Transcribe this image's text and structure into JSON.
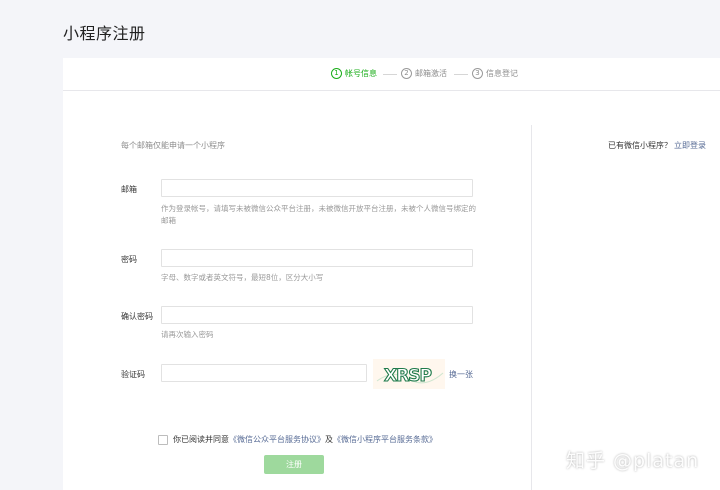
{
  "page": {
    "title": "小程序注册"
  },
  "steps": [
    {
      "num": "1",
      "label": "帐号信息"
    },
    {
      "num": "2",
      "label": "邮箱激活"
    },
    {
      "num": "3",
      "label": "信息登记"
    }
  ],
  "side": {
    "hint": "已有微信小程序？",
    "login_link": "立即登录"
  },
  "form": {
    "intro": "每个邮箱仅能申请一个小程序",
    "email_label": "邮箱",
    "email_tip": "作为登录帐号，请填写未被微信公众平台注册，未被微信开放平台注册，未被个人微信号绑定的邮箱",
    "password_label": "密码",
    "password_tip": "字母、数字或者英文符号，最短8位，区分大小写",
    "confirm_label": "确认密码",
    "confirm_tip": "请再次输入密码",
    "captcha_label": "验证码",
    "captcha_text": "XRSP",
    "refresh_link": "换一张",
    "agree_prefix": "你已阅读并同意",
    "agree_link1": "《微信公众平台服务协议》",
    "agree_mid": "及",
    "agree_link2": "《微信小程序平台服务条款》",
    "submit_label": "注册"
  },
  "watermark": "知乎 @platan",
  "colors": {
    "accent": "#1aad19",
    "link": "#576b95",
    "button_disabled": "#9ed99d"
  }
}
